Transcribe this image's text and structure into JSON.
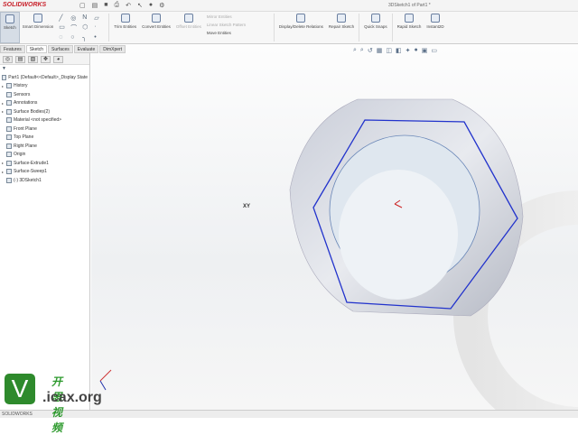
{
  "app": {
    "logo": "SOLIDWORKS",
    "doc_title": "3DSketch1 of Part1 *"
  },
  "ribbon": {
    "sketch": "Sketch",
    "smart_dimension": "Smart Dimension",
    "trim": "Trim Entities",
    "convert": "Convert Entities",
    "offset": "Offset Entities",
    "mirror": "Mirror Entities",
    "linear_pattern": "Linear Sketch Pattern",
    "move": "Move Entities",
    "display_delete": "Display/Delete Relations",
    "repair": "Repair Sketch",
    "quick_snaps": "Quick Snaps",
    "rapid": "Rapid Sketch",
    "instant2d": "Instant2D"
  },
  "tabs": [
    "Features",
    "Sketch",
    "Surfaces",
    "Evaluate",
    "DimXpert"
  ],
  "tree": {
    "root": "Part1  (Default<<Default>_Display State",
    "items": [
      {
        "label": "History",
        "arrow": true
      },
      {
        "label": "Sensors",
        "arrow": false
      },
      {
        "label": "Annotations",
        "arrow": true
      },
      {
        "label": "Surface Bodies(2)",
        "arrow": true
      },
      {
        "label": "Material <not specified>",
        "arrow": false
      },
      {
        "label": "Front Plane",
        "arrow": false
      },
      {
        "label": "Top Plane",
        "arrow": false
      },
      {
        "label": "Right Plane",
        "arrow": false
      },
      {
        "label": "Origin",
        "arrow": false
      },
      {
        "label": "Surface-Extrude1",
        "arrow": true
      },
      {
        "label": "Surface-Sweep1",
        "arrow": true
      },
      {
        "label": "(-) 3DSketch1",
        "arrow": false
      }
    ]
  },
  "viewport": {
    "origin_label": "XY"
  },
  "status": {
    "text": "SOLIDWORKS"
  },
  "watermark": {
    "letter": "V",
    "cn": "开思视频",
    "en": ".icax.org"
  },
  "colors": {
    "sketch_blue": "#2233cc",
    "brand_red": "#c8202a",
    "watermark_green": "#2e8a2c"
  }
}
